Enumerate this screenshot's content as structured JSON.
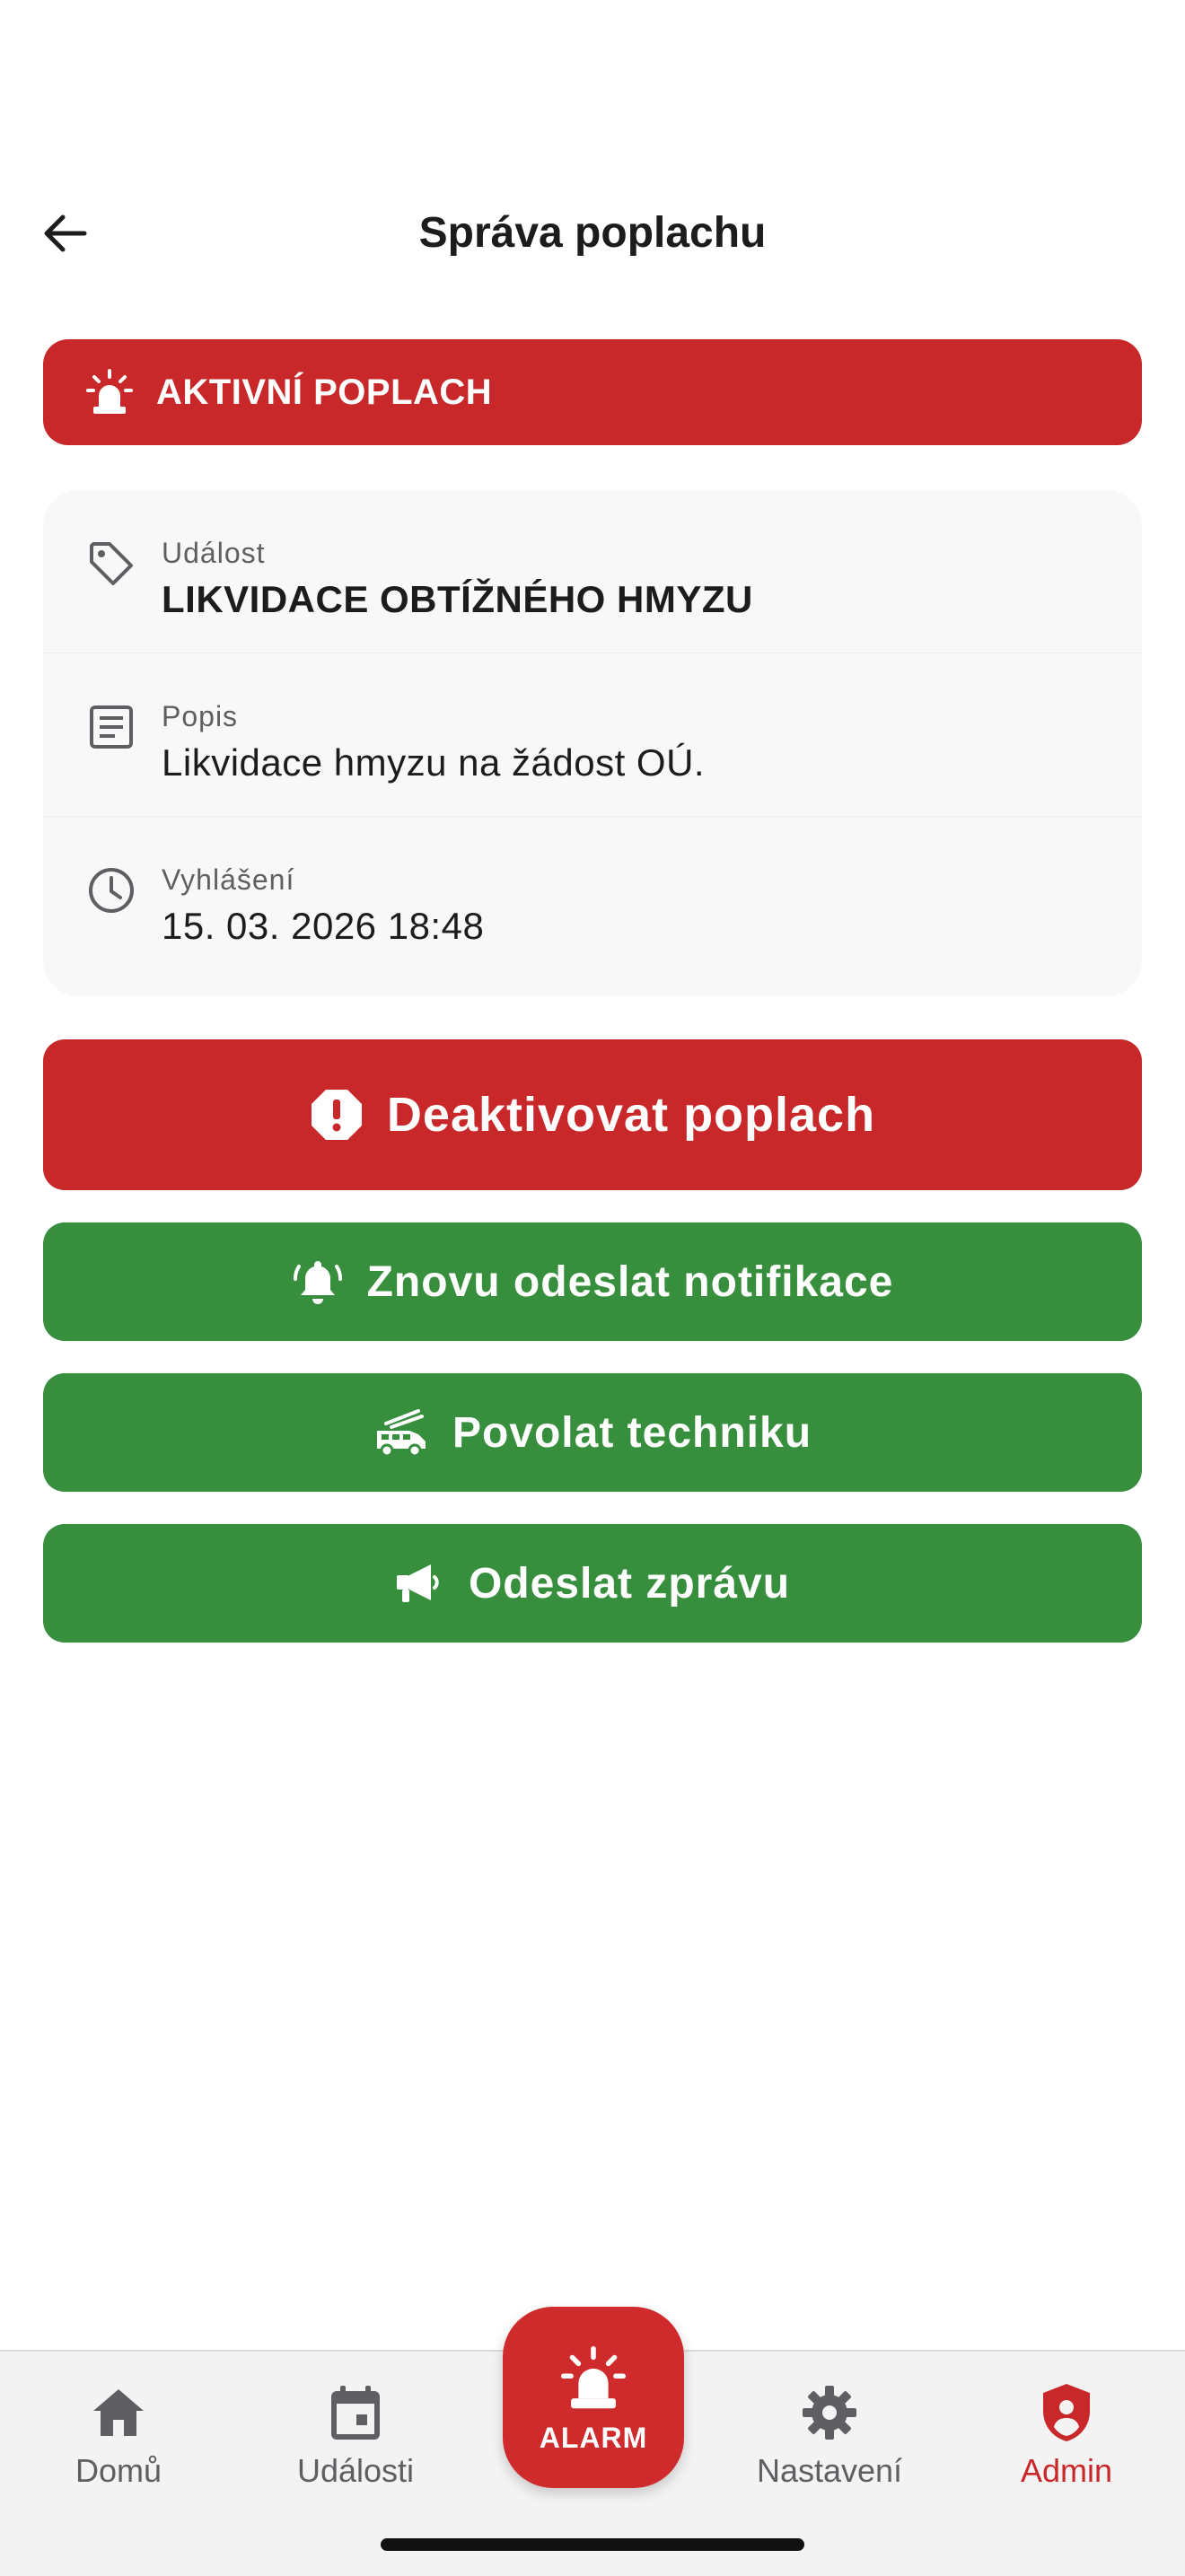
{
  "header": {
    "title": "Správa poplachu",
    "back_icon": "arrow-left-icon"
  },
  "banner": {
    "text": "AKTIVNÍ POPLACH",
    "icon": "siren-icon",
    "color": "#c8282a"
  },
  "details": [
    {
      "icon": "tag-icon",
      "label": "Událost",
      "value": "LIKVIDACE OBTÍŽNÉHO HMYZU"
    },
    {
      "icon": "description-icon",
      "label": "Popis",
      "value": "Likvidace hmyzu na žádost OÚ."
    },
    {
      "icon": "clock-icon",
      "label": "Vyhlášení",
      "value": "15. 03. 2026 18:48"
    }
  ],
  "actions": {
    "deactivate": {
      "label": "Deaktivovat poplach",
      "icon": "alert-octagon-icon",
      "color": "#c8282a"
    },
    "resend": {
      "label": "Znovu odeslat notifikace",
      "icon": "bell-ring-icon",
      "color": "#378f3d"
    },
    "vehicles": {
      "label": "Povolat techniku",
      "icon": "fire-truck-icon",
      "color": "#378f3d"
    },
    "message": {
      "label": "Odeslat zprávu",
      "icon": "megaphone-icon",
      "color": "#378f3d"
    }
  },
  "nav": {
    "items": [
      {
        "label": "Domů",
        "icon": "home-icon"
      },
      {
        "label": "Události",
        "icon": "calendar-icon"
      },
      {
        "label": "Nastavení",
        "icon": "gear-icon"
      },
      {
        "label": "Admin",
        "icon": "admin-shield-icon",
        "active": true
      }
    ],
    "fab": {
      "label": "ALARM",
      "icon": "siren-icon"
    },
    "active_color": "#c8282a"
  }
}
